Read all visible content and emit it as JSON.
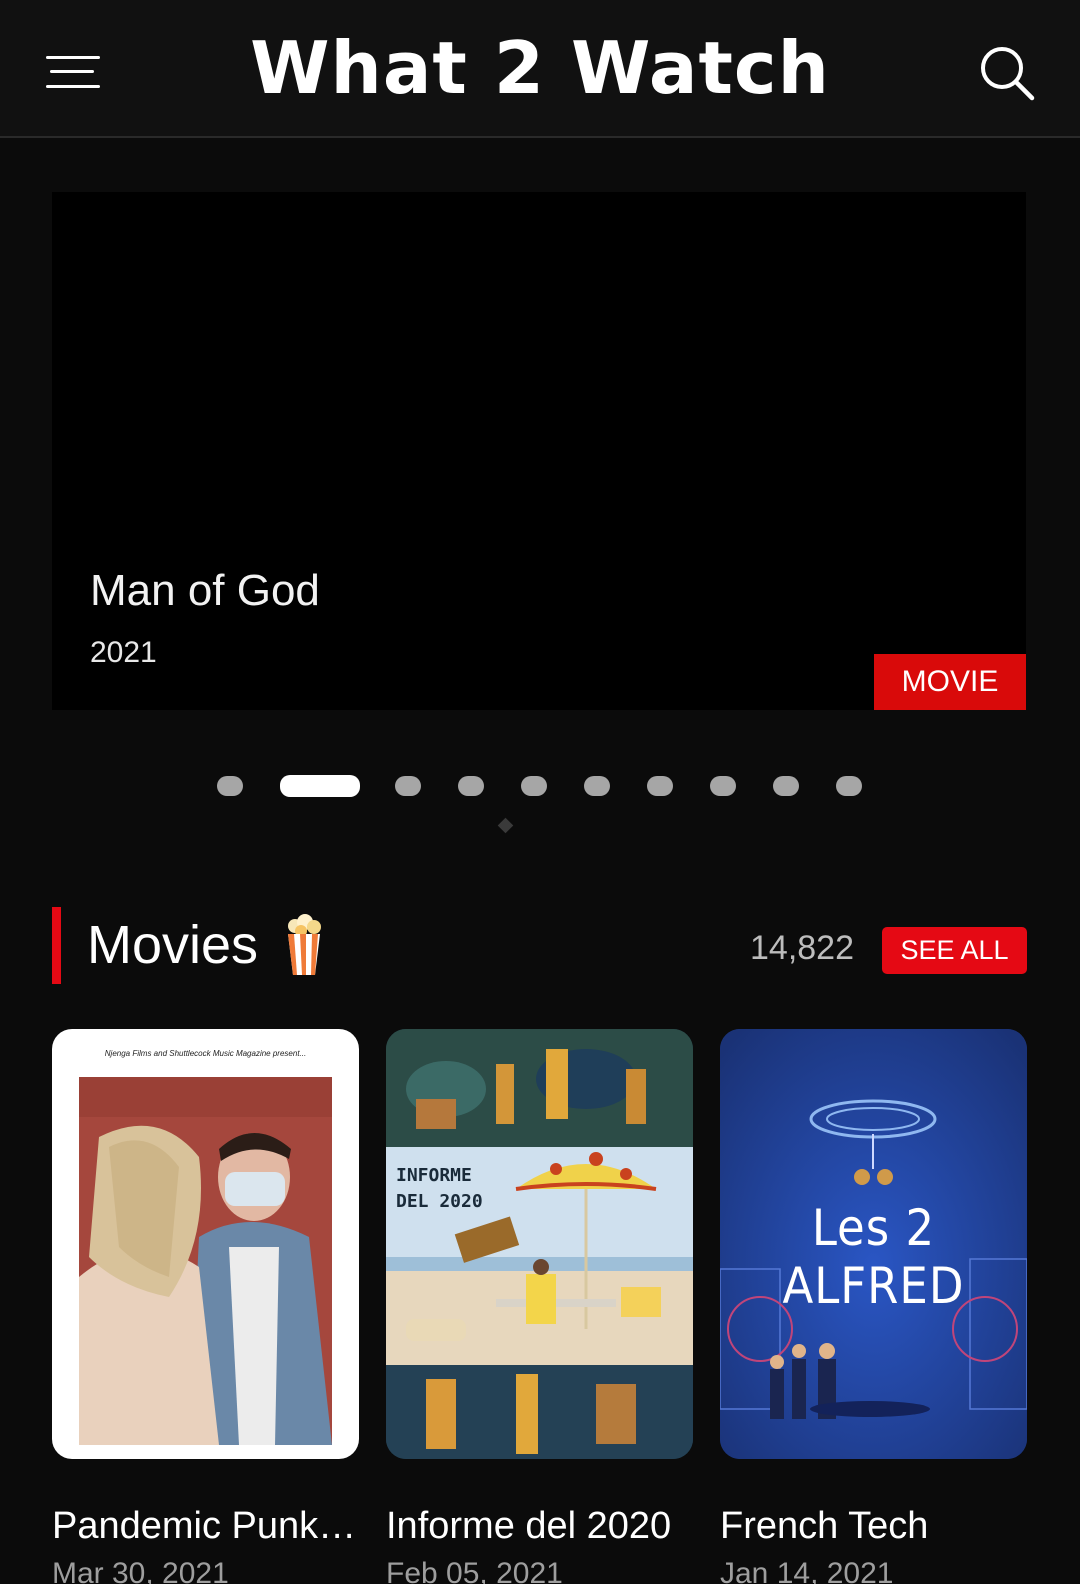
{
  "header": {
    "title": "What 2 Watch",
    "menu_icon": "hamburger-menu-icon",
    "search_icon": "search-icon"
  },
  "hero": {
    "title": "Man of God",
    "year": "2021",
    "badge": "MOVIE",
    "slide_count": 10,
    "active_slide": 2
  },
  "movies_section": {
    "title": "Movies",
    "emoji_icon": "popcorn-icon",
    "count": "14,822",
    "see_all_label": "SEE ALL",
    "items": [
      {
        "title": "Pandemic Punk ...",
        "date": "Mar 30, 2021",
        "poster_text": "Njenga Films and Shuttlecock Music Magazine present..."
      },
      {
        "title": "Informe del 2020",
        "date": "Feb 05, 2021",
        "poster_text": "INFORME DEL 2020"
      },
      {
        "title": "French Tech",
        "date": "Jan 14, 2021",
        "poster_text": "Les 2 ALFRED"
      }
    ]
  },
  "colors": {
    "background": "#0b0b0b",
    "accent_red": "#e50914",
    "badge_red": "#d90a0a",
    "muted_text": "#9e9e9e"
  }
}
